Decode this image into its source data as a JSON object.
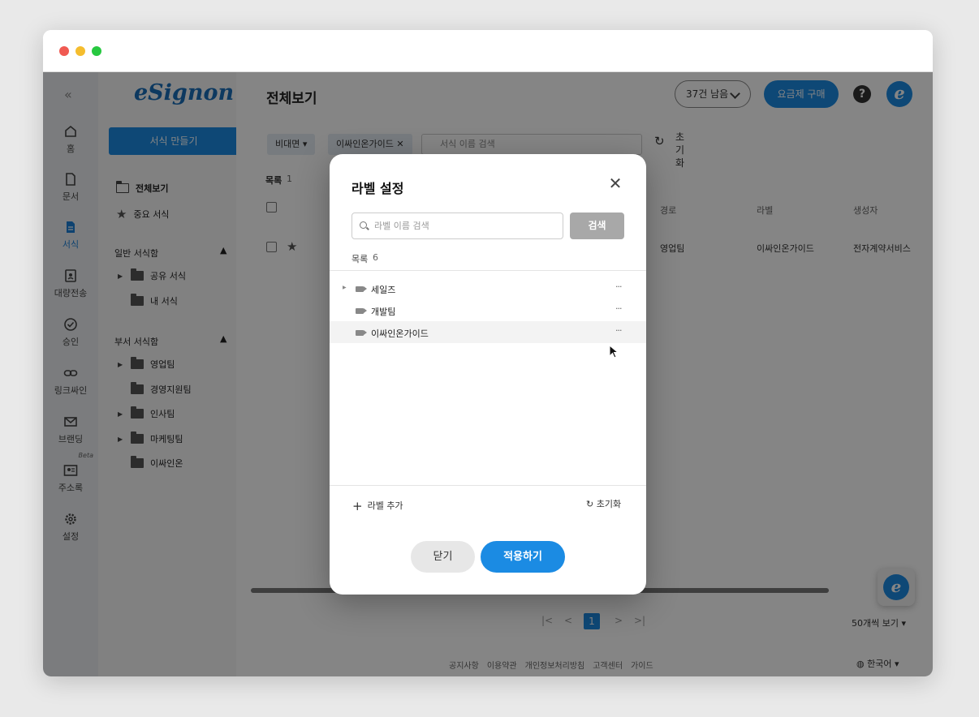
{
  "sidebar_rail": {
    "items": [
      {
        "label": "홈",
        "icon": "home-icon"
      },
      {
        "label": "문서",
        "icon": "document-icon"
      },
      {
        "label": "서식",
        "icon": "template-icon"
      },
      {
        "label": "대량전송",
        "icon": "bulk-send-icon"
      },
      {
        "label": "승인",
        "icon": "approval-icon"
      },
      {
        "label": "링크싸인",
        "icon": "link-icon"
      },
      {
        "label": "브랜딩",
        "icon": "mail-icon"
      },
      {
        "label": "주소록",
        "icon": "contacts-icon",
        "badge": "Beta"
      },
      {
        "label": "설정",
        "icon": "gear-icon"
      }
    ],
    "active_index": 2
  },
  "side_panel": {
    "logo": "eSignon",
    "make_button": "서식 만들기",
    "view_all": "전체보기",
    "important": "중요 서식",
    "general_header": "일반 서식함",
    "general_items": [
      "공유 서식",
      "내 서식"
    ],
    "dept_header": "부서 서식함",
    "dept_items": [
      "영업팀",
      "경영지원팀",
      "인사팀",
      "마케팅팀",
      "이싸인온"
    ]
  },
  "header": {
    "title": "전체보기",
    "remaining": "37건 남음",
    "buy_button": "요금제 구매"
  },
  "filters": {
    "chip1": "비대면",
    "chip2": "이싸인온가이드",
    "search_placeholder": "서식 이름 검색",
    "reset_label": "초기화"
  },
  "list": {
    "label": "목록",
    "count": "1",
    "columns": [
      "경로",
      "라벨",
      "생성자"
    ],
    "row": {
      "path": "영업팀",
      "label": "이싸인온가이드",
      "creator": "전자계약서비스"
    }
  },
  "pagination": {
    "current": "1",
    "per_page": "50개씩 보기"
  },
  "footer": {
    "links": [
      "공지사항",
      "이용약관",
      "개인정보처리방침",
      "고객센터",
      "가이드"
    ],
    "language": "한국어"
  },
  "modal": {
    "title": "라벨 설정",
    "search_placeholder": "라벨 이름 검색",
    "search_button": "검색",
    "list_label": "목록",
    "list_count": "6",
    "labels": [
      "세일즈",
      "개발팀",
      "이싸인온가이드"
    ],
    "add_label": "라벨 추가",
    "reset": "초기화",
    "cancel": "닫기",
    "apply": "적용하기"
  },
  "colors": {
    "accent": "#1b8be3",
    "overlay": "rgba(0,0,0,0.48)"
  }
}
